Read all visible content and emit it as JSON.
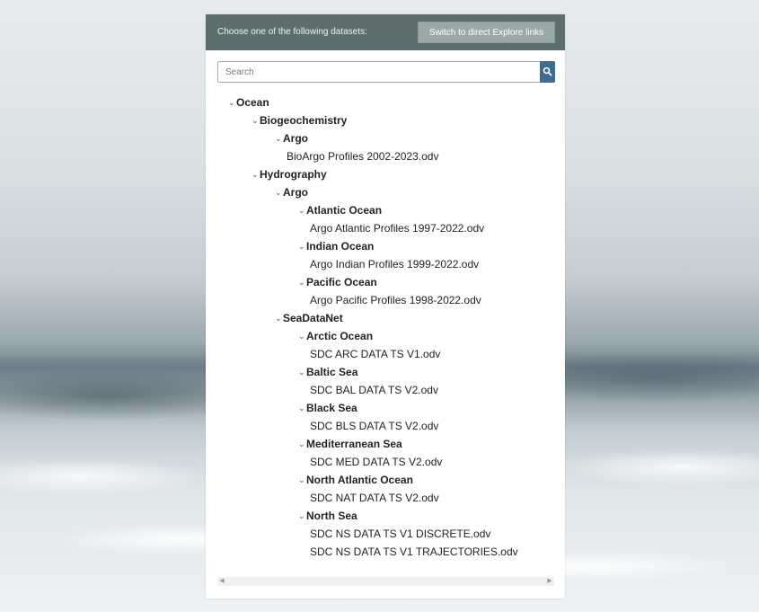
{
  "header": {
    "prompt": "Choose one of the following datasets:",
    "switch_label": "Switch to direct Explore links"
  },
  "search": {
    "placeholder": "Search",
    "button_icon": "search-icon"
  },
  "tree": [
    {
      "label": "Ocean",
      "type": "folder",
      "depth": 0
    },
    {
      "label": "Biogeochemistry",
      "type": "folder",
      "depth": 1
    },
    {
      "label": "Argo",
      "type": "folder",
      "depth": 2
    },
    {
      "label": "BioArgo Profiles 2002-2023.odv",
      "type": "file",
      "depth": 3
    },
    {
      "label": "Hydrography",
      "type": "folder",
      "depth": 1
    },
    {
      "label": "Argo",
      "type": "folder",
      "depth": 2
    },
    {
      "label": "Atlantic Ocean",
      "type": "folder",
      "depth": 3
    },
    {
      "label": "Argo Atlantic Profiles 1997-2022.odv",
      "type": "file",
      "depth": 4
    },
    {
      "label": "Indian Ocean",
      "type": "folder",
      "depth": 3
    },
    {
      "label": "Argo Indian Profiles 1999-2022.odv",
      "type": "file",
      "depth": 4
    },
    {
      "label": "Pacific Ocean",
      "type": "folder",
      "depth": 3
    },
    {
      "label": "Argo Pacific Profiles 1998-2022.odv",
      "type": "file",
      "depth": 4
    },
    {
      "label": "SeaDataNet",
      "type": "folder",
      "depth": 2
    },
    {
      "label": "Arctic Ocean",
      "type": "folder",
      "depth": 3
    },
    {
      "label": "SDC ARC DATA TS V1.odv",
      "type": "file",
      "depth": 4
    },
    {
      "label": "Baltic Sea",
      "type": "folder",
      "depth": 3
    },
    {
      "label": "SDC BAL DATA TS V2.odv",
      "type": "file",
      "depth": 4
    },
    {
      "label": "Black Sea",
      "type": "folder",
      "depth": 3
    },
    {
      "label": "SDC BLS DATA TS V2.odv",
      "type": "file",
      "depth": 4
    },
    {
      "label": "Mediterranean Sea",
      "type": "folder",
      "depth": 3
    },
    {
      "label": "SDC MED DATA TS V2.odv",
      "type": "file",
      "depth": 4
    },
    {
      "label": "North Atlantic Ocean",
      "type": "folder",
      "depth": 3
    },
    {
      "label": "SDC NAT DATA TS V2.odv",
      "type": "file",
      "depth": 4
    },
    {
      "label": "North Sea",
      "type": "folder",
      "depth": 3
    },
    {
      "label": "SDC NS DATA TS V1 DISCRETE.odv",
      "type": "file",
      "depth": 4
    },
    {
      "label": "SDC NS DATA TS V1 TRAJECTORIES.odv",
      "type": "file",
      "depth": 4
    }
  ],
  "colors": {
    "header_bg": "#5d6e6f",
    "switch_button_bg": "#9aa8aa",
    "search_button_bg": "#3c6d93"
  }
}
